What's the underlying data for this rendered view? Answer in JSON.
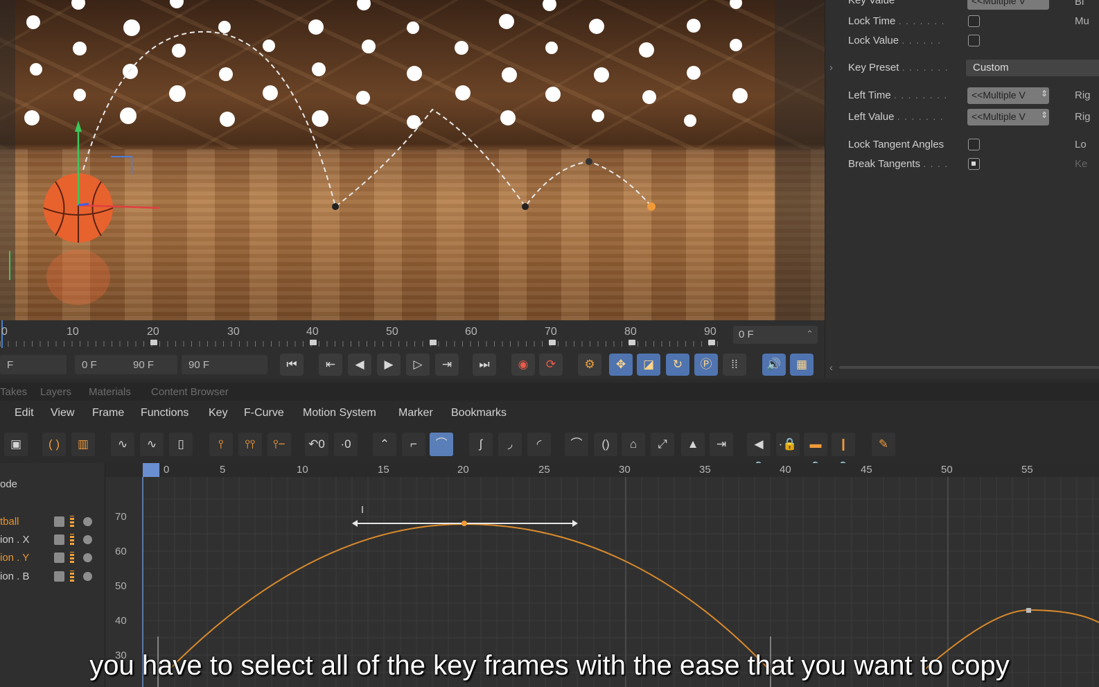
{
  "attributes": {
    "key_value_label": "Key Value",
    "multiple_value": "<<Multiple V",
    "lock_time": "Lock Time",
    "lock_value": "Lock Value",
    "key_preset": "Key Preset",
    "key_preset_value": "Custom",
    "left_time": "Left  Time",
    "left_value": "Left  Value",
    "lock_tangent_angles": "Lock Tangent Angles",
    "break_tangents": "Break Tangents",
    "right_cut_1": "Bi",
    "right_cut_2": "Mu",
    "right_cut_3": "Rig",
    "right_cut_4": "Rig",
    "right_cut_5": "Lo",
    "right_cut_6": "Ke",
    "break_tangents_checked": true
  },
  "timeline": {
    "ruler_labels": [
      "0",
      "10",
      "20",
      "30",
      "40",
      "50",
      "60",
      "70",
      "80",
      "90"
    ],
    "current_frame": "0 F"
  },
  "transport": {
    "field_start": "F",
    "field_min": "0 F",
    "field_max": "90 F",
    "field_end": "90 F"
  },
  "tabs": [
    "Takes",
    "Layers",
    "Materials",
    "Content Browser"
  ],
  "menu": [
    "Edit",
    "View",
    "Frame",
    "Functions",
    "Key",
    "F-Curve",
    "Motion System",
    "Marker",
    "Bookmarks"
  ],
  "objects": {
    "header": "ode",
    "rows": [
      {
        "label": "tball",
        "color": "#e8952f"
      },
      {
        "label": "ion . X",
        "color": "#cfcfcf"
      },
      {
        "label": "ion . Y",
        "color": "#e8952f"
      },
      {
        "label": "ion . B",
        "color": "#cfcfcf"
      }
    ]
  },
  "graph": {
    "frame_labels": [
      "0",
      "5",
      "10",
      "15",
      "20",
      "25",
      "30",
      "35",
      "40",
      "45",
      "50",
      "55"
    ],
    "value_labels": [
      "70",
      "60",
      "50",
      "40",
      "30"
    ]
  },
  "subtitle": "you have to select all of the key frames with the ease that you want to copy",
  "colors": {
    "accent_orange": "#f09a3a",
    "active_blue": "#5a7fb8",
    "curve": "#d98a2c"
  }
}
